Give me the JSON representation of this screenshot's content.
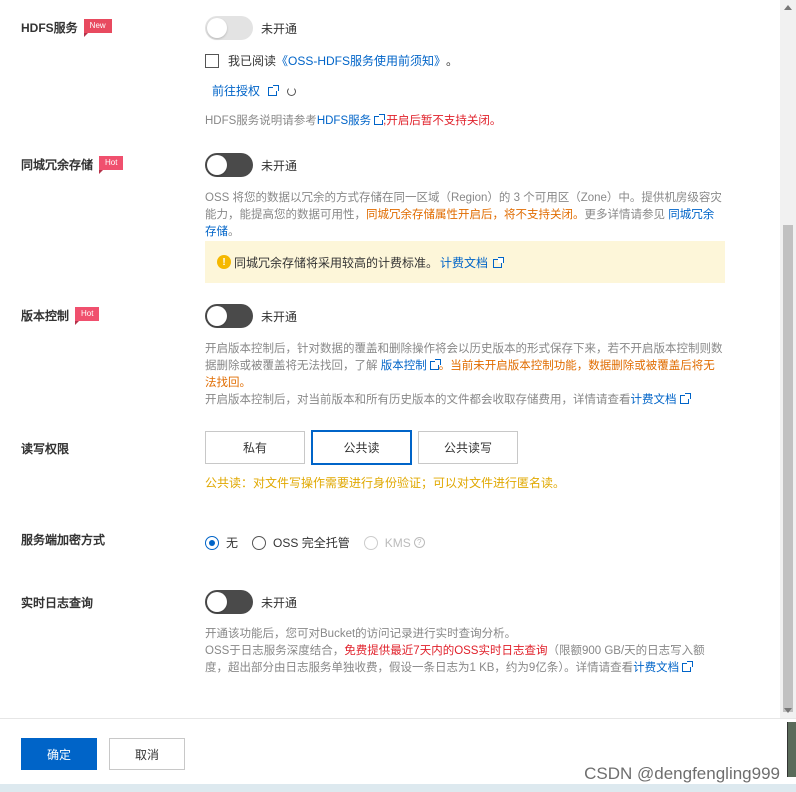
{
  "hdfs": {
    "label": "HDFS服务",
    "badge": "New",
    "status": "未开通",
    "checkbox_prefix": "我已阅读",
    "checkbox_link": "《OSS-HDFS服务使用前须知》",
    "checkbox_suffix": "。",
    "auth_link": "前往授权",
    "desc_prefix": "HDFS服务说明请参考",
    "desc_link": "HDFS服务",
    "desc_warn": ",开启后暂不支持关闭。"
  },
  "redundancy": {
    "label": "同城冗余存储",
    "badge": "Hot",
    "status": "未开通",
    "desc_1": "OSS 将您的数据以冗余的方式存储在同一区域（Region）的 3 个可用区（Zone）中。提供机房级容灾能力，能提高您的数据可用性，",
    "desc_warn": "同城冗余存储属性开启后，将不支持关闭。",
    "desc_2": "更多详情请参见",
    "desc_link": "同城冗余存储",
    "desc_end": "。",
    "notice_text": "同城冗余存储将采用较高的计费标准。",
    "notice_link": "计费文档"
  },
  "versioning": {
    "label": "版本控制",
    "badge": "Hot",
    "status": "未开通",
    "desc_1": "开启版本控制后，针对数据的覆盖和删除操作将会以历史版本的形式保存下来，若不开启版本控制则数据删除或被覆盖将无法找回，了解",
    "desc_link": "版本控制",
    "desc_warn": "。当前未开启版本控制功能，数据删除或被覆盖后将无法找回。",
    "desc_2": "开启版本控制后，对当前版本和所有历史版本的文件都会收取存储费用，详情请查看",
    "desc_link2": "计费文档"
  },
  "acl": {
    "label": "读写权限",
    "options": [
      "私有",
      "公共读",
      "公共读写"
    ],
    "selected": "公共读",
    "hint": "公共读：对文件写操作需要进行身份验证；可以对文件进行匿名读。"
  },
  "encryption": {
    "label": "服务端加密方式",
    "options": [
      "无",
      "OSS 完全托管",
      "KMS"
    ],
    "selected": "无"
  },
  "logging": {
    "label": "实时日志查询",
    "status": "未开通",
    "desc_1": "开通该功能后，您可对Bucket的访问记录进行实时查询分析。",
    "desc_2": "OSS于日志服务深度结合，",
    "desc_warn": "免费提供最近7天内的OSS实时日志查询",
    "desc_3": "（限额900 GB/天的日志写入额度，超出部分由日志服务单独收费，假设一条日志为1 KB，约为9亿条）。详情请查看",
    "desc_link": "计费文档"
  },
  "footer": {
    "confirm": "确定",
    "cancel": "取消"
  },
  "watermark": "CSDN @dengfengling999",
  "colors": {
    "primary": "#0064c8",
    "warning": "#e06c00",
    "danger": "#e0202a",
    "notice_bg": "#fdf6d9"
  }
}
